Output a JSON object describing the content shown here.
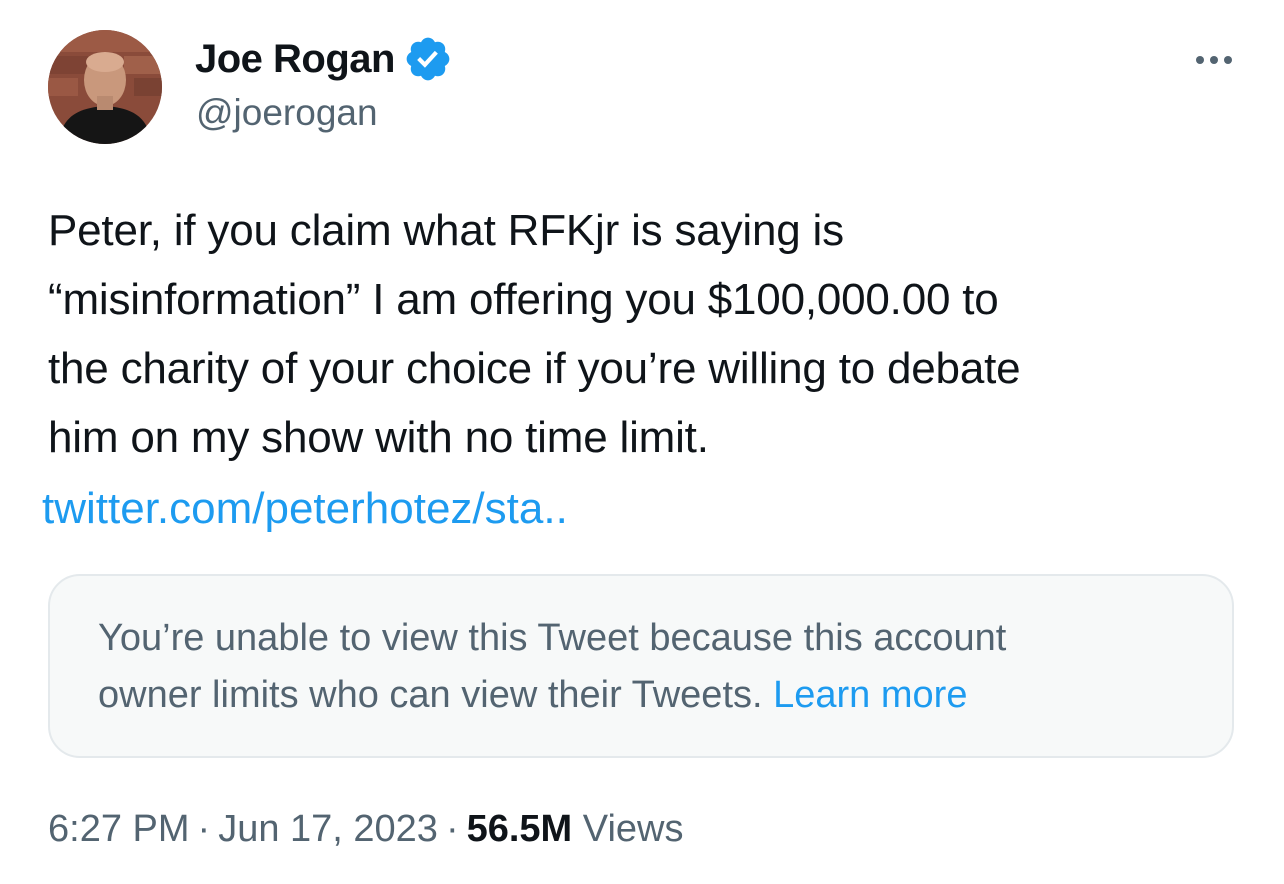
{
  "author": {
    "display_name": "Joe Rogan",
    "handle": "@joerogan",
    "verified": true,
    "avatar_icon": "profile-photo-avatar"
  },
  "more_icon": "more-horizontal-icon",
  "tweet": {
    "text_lines": [
      "Peter, if you claim what RFKjr is saying is",
      "“misinformation” I am offering you $100,000.00 to",
      "the charity of your choice if you’re willing to debate",
      "him on my show with no time limit."
    ],
    "link": "twitter.com/peterhotez/sta.."
  },
  "quoted_tweet_notice": {
    "line_1": "You’re unable to view this Tweet because this account",
    "line_2": "owner limits who can view their Tweets.",
    "learn_more": "Learn more"
  },
  "meta": {
    "time": "6:27 PM",
    "separator": "·",
    "date": "Jun 17, 2023",
    "views_count": "56.5M",
    "views_label": "Views"
  },
  "colors": {
    "link": "#1d9bf0",
    "secondary_text": "#536471",
    "primary_text": "#0f1419",
    "verified_badge": "#1d9bf0",
    "notice_background": "#f7f9f9"
  }
}
